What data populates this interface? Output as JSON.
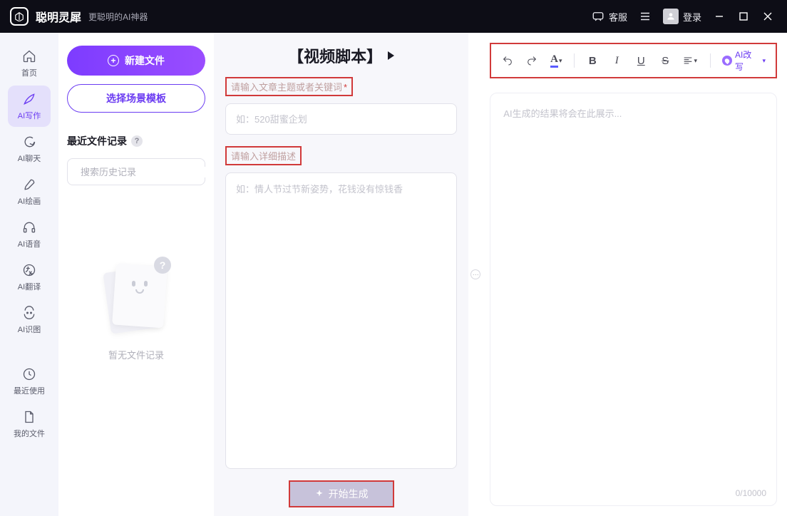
{
  "header": {
    "app_name": "聪明灵犀",
    "tagline": "更聪明的AI神器",
    "kefu": "客服",
    "login": "登录"
  },
  "sidebar": {
    "items": [
      {
        "label": "首页",
        "icon": "home"
      },
      {
        "label": "AI写作",
        "icon": "pen",
        "active": true
      },
      {
        "label": "AI聊天",
        "icon": "chat"
      },
      {
        "label": "AI绘画",
        "icon": "brush"
      },
      {
        "label": "AI语音",
        "icon": "audio"
      },
      {
        "label": "AI翻译",
        "icon": "translate"
      },
      {
        "label": "AI识图",
        "icon": "vision"
      }
    ],
    "items2": [
      {
        "label": "最近使用",
        "icon": "recent"
      },
      {
        "label": "我的文件",
        "icon": "file"
      }
    ]
  },
  "left": {
    "new_file": "新建文件",
    "choose_template": "选择场景模板",
    "recent_title": "最近文件记录",
    "search_placeholder": "搜索历史记录",
    "empty_text": "暂无文件记录"
  },
  "mid": {
    "title": "【视频脚本】",
    "label_topic": "请输入文章主题或者关键词",
    "topic_placeholder": "如：520甜蜜企划",
    "label_desc": "请输入详细描述",
    "desc_placeholder": "如：情人节过节新姿势，花钱没有惊钱香",
    "generate": "开始生成"
  },
  "right": {
    "ai_rewrite": "AI改写",
    "placeholder": "AI生成的结果将会在此展示...",
    "counter": "0/10000"
  }
}
